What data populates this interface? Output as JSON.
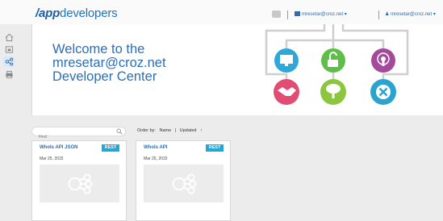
{
  "header": {
    "logo_prefix": "/app",
    "logo_suffix": "developers",
    "org_label": "mresetar@croz.net",
    "user_label": "mresetar@croz.net"
  },
  "sidebar": {
    "items": [
      {
        "name": "home-icon"
      },
      {
        "name": "cube-icon"
      },
      {
        "name": "share-icon"
      },
      {
        "name": "printer-icon"
      }
    ]
  },
  "banner": {
    "line1": "Welcome to the",
    "line2": "mresetar@croz.net",
    "line3": "Developer Center",
    "icons": [
      "monitor-icon",
      "unlock-icon",
      "touch-icon",
      "handshake-icon",
      "tree-icon",
      "close-icon"
    ],
    "colors": {
      "blue": "#2fa8d9",
      "green": "#5dbf47",
      "purple": "#a44a9a",
      "pink": "#e24c73",
      "lime": "#8cc63f",
      "teal": "#2aa3cf"
    }
  },
  "toolbar": {
    "search_placeholder": "Find",
    "order_label": "Order by:",
    "order_name": "Name",
    "order_sep": "|",
    "order_updated": "Updated",
    "order_arrow": "↑"
  },
  "apis": [
    {
      "title": "WhoIs API JSON",
      "badge": "REST",
      "date": "Mar 25, 2015"
    },
    {
      "title": "WhoIs API",
      "badge": "REST",
      "date": "Mar 25, 2015"
    }
  ]
}
